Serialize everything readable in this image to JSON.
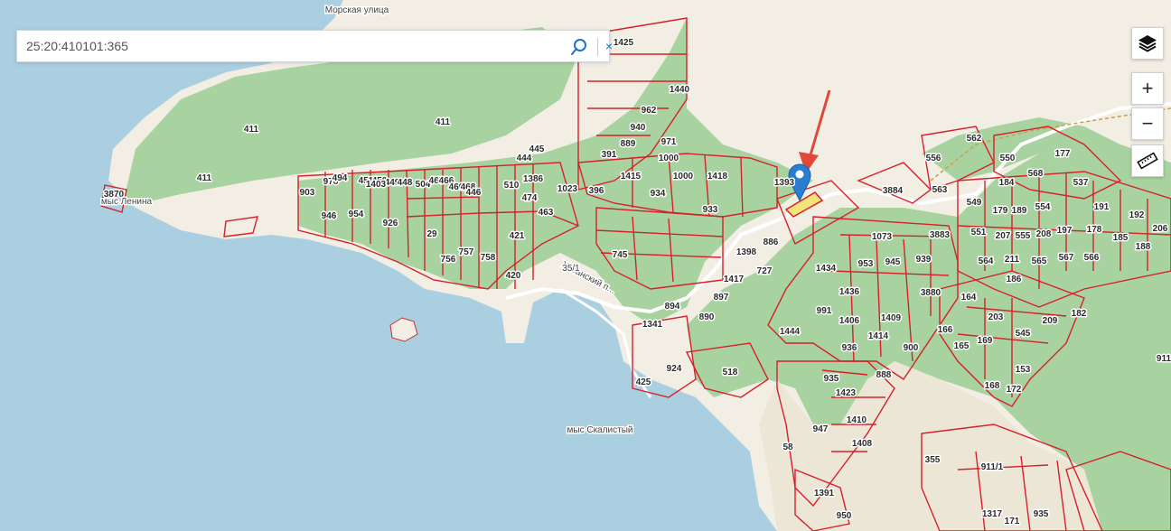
{
  "search": {
    "value": "25:20:410101:365",
    "clear_label": "×"
  },
  "controls": {
    "layers_icon": "layers-icon",
    "zoom_in_label": "+",
    "zoom_out_label": "−",
    "ruler_icon": "ruler-icon"
  },
  "map": {
    "streets": [
      "Морская улица",
      "Хасанский п..."
    ],
    "places": [
      "мыс Ленина",
      "мыс Скалистый",
      "35/1"
    ],
    "parcels": [
      "1425",
      "1440",
      "962",
      "940",
      "971",
      "1000",
      "1000",
      "1418",
      "889",
      "391",
      "1415",
      "934",
      "933",
      "411",
      "411",
      "411",
      "903",
      "978",
      "494",
      "451",
      "450",
      "449",
      "448",
      "946",
      "954",
      "1403",
      "926",
      "504",
      "467",
      "466",
      "460",
      "468",
      "446",
      "1386",
      "510",
      "474",
      "444",
      "445",
      "1023",
      "396",
      "463",
      "29",
      "421",
      "756",
      "757",
      "758",
      "420",
      "745",
      "1393",
      "886",
      "1398",
      "727",
      "1417",
      "897",
      "890",
      "894",
      "1341",
      "924",
      "425",
      "518",
      "1073",
      "3883",
      "953",
      "945",
      "939",
      "1434",
      "1436",
      "3880",
      "991",
      "1406",
      "1409",
      "1414",
      "936",
      "900",
      "1444",
      "888",
      "935",
      "1423",
      "947",
      "1410",
      "1408",
      "58",
      "1391",
      "950",
      "355",
      "911/1",
      "3884",
      "556",
      "563",
      "562",
      "550",
      "568",
      "177",
      "184",
      "537",
      "549",
      "179",
      "189",
      "554",
      "191",
      "192",
      "206",
      "551",
      "207",
      "555",
      "208",
      "197",
      "178",
      "185",
      "188",
      "564",
      "211",
      "565",
      "567",
      "566",
      "186",
      "164",
      "203",
      "545",
      "209",
      "182",
      "166",
      "165",
      "169",
      "153",
      "168",
      "172",
      "911",
      "1317",
      "171",
      "935",
      "3870"
    ]
  },
  "colors": {
    "sea": "#aacfe0",
    "forest": "#a8d3a0",
    "land": "#f2eee4",
    "parcel_border": "#d6202a",
    "selected_parcel": "#f3e37a",
    "marker": "#2a7dd1",
    "arrow": "#e0483a",
    "topbar": "#1565c0"
  }
}
